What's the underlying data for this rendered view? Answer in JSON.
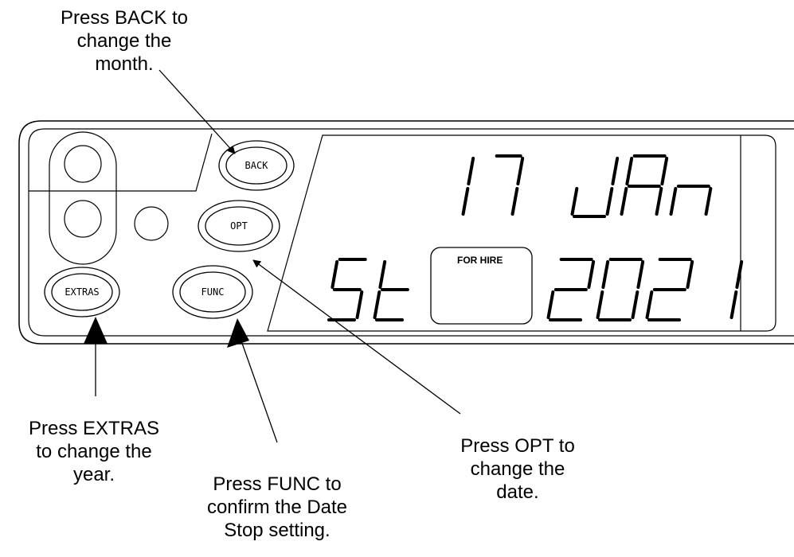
{
  "callouts": {
    "back": {
      "lines": [
        "Press BACK to",
        "change the",
        "month."
      ]
    },
    "extras": {
      "lines": [
        "Press EXTRAS",
        "to change the",
        "year."
      ]
    },
    "func": {
      "lines": [
        "Press FUNC to",
        "confirm the Date",
        "Stop setting."
      ]
    },
    "opt": {
      "lines": [
        "Press OPT to",
        "change the",
        "date."
      ]
    }
  },
  "buttons": {
    "back": "BACK",
    "opt": "OPT",
    "extras": "EXTRAS",
    "func": "FUNC"
  },
  "display": {
    "day": "17",
    "month": "JAn",
    "mode": "St",
    "year": "2021",
    "for_hire": "FOR HIRE"
  }
}
